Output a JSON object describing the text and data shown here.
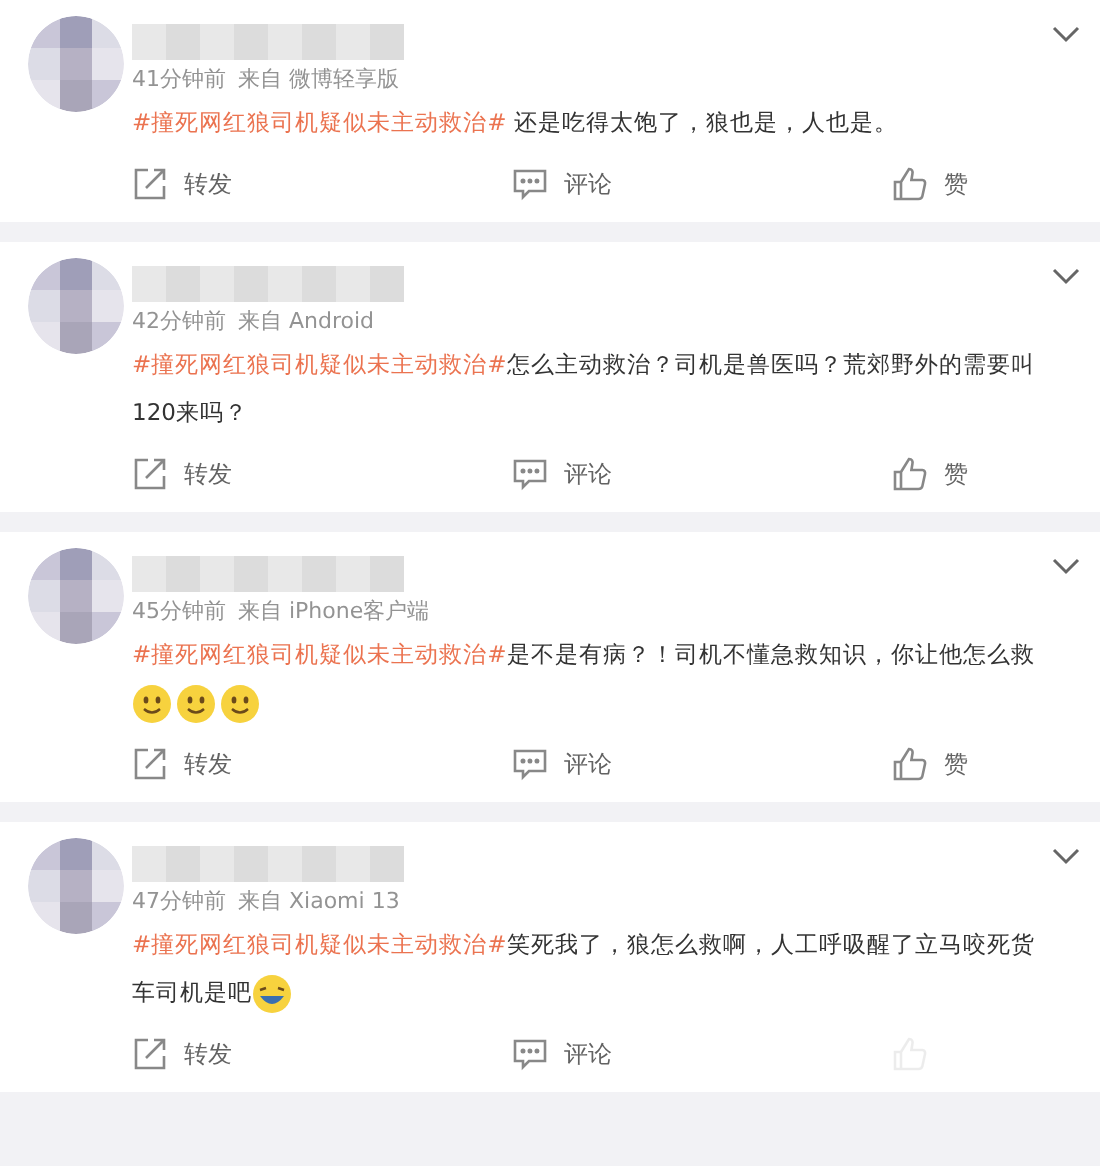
{
  "posts": [
    {
      "time": "41分钟前",
      "source": "来自 微博轻享版",
      "body": [
        {
          "kind": "hashtag",
          "text": "#撞死网红狼司机疑似未主动救治#"
        },
        {
          "kind": "text",
          "text": " 还是吃得太饱了，狼也是，人也是。"
        }
      ],
      "actions": {
        "repost": "转发",
        "comment": "评论",
        "like": "赞"
      }
    },
    {
      "time": "42分钟前",
      "source": "来自 Android",
      "body": [
        {
          "kind": "hashtag",
          "text": "#撞死网红狼司机疑似未主动救治#"
        },
        {
          "kind": "text",
          "text": "怎么主动救治？司机是兽医吗？荒郊野外的需要叫120来吗？"
        }
      ],
      "actions": {
        "repost": "转发",
        "comment": "评论",
        "like": "赞"
      }
    },
    {
      "time": "45分钟前",
      "source": "来自 iPhone客户端",
      "body": [
        {
          "kind": "hashtag",
          "text": "#撞死网红狼司机疑似未主动救治#"
        },
        {
          "kind": "text",
          "text": "是不是有病？！司机不懂急救知识，你让他怎么救"
        },
        {
          "kind": "smile_emoji"
        },
        {
          "kind": "smile_emoji"
        },
        {
          "kind": "smile_emoji"
        }
      ],
      "actions": {
        "repost": "转发",
        "comment": "评论",
        "like": "赞"
      }
    },
    {
      "time": "47分钟前",
      "source": "来自 Xiaomi 13",
      "body": [
        {
          "kind": "hashtag",
          "text": "#撞死网红狼司机疑似未主动救治#"
        },
        {
          "kind": "text",
          "text": "笑死我了，狼怎么救啊，人工呼吸醒了立马咬死货车司机是吧"
        },
        {
          "kind": "laugh_emoji"
        }
      ],
      "actions": {
        "repost": "转发",
        "comment": "评论"
      }
    }
  ]
}
